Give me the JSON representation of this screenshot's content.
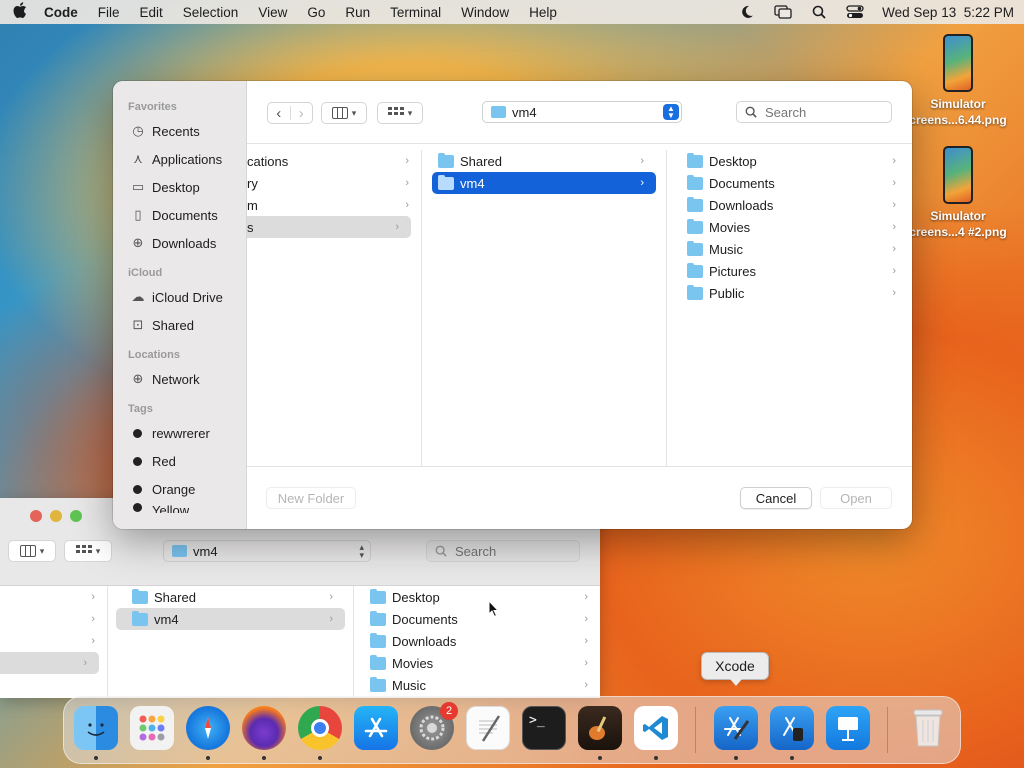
{
  "menubar": {
    "app": "Code",
    "items": [
      "File",
      "Edit",
      "Selection",
      "View",
      "Go",
      "Run",
      "Terminal",
      "Window",
      "Help"
    ],
    "clock": "Wed Sep 13  5:22 PM"
  },
  "desktop": {
    "icons": [
      {
        "line1": "Simulator",
        "line2": "creens...6.44.png"
      },
      {
        "line1": "Simulator",
        "line2": "creens...4 #2.png"
      }
    ]
  },
  "dialog": {
    "sidebar": {
      "favorites_label": "Favorites",
      "favorites": [
        "Recents",
        "Applications",
        "Desktop",
        "Documents",
        "Downloads"
      ],
      "icloud_label": "iCloud",
      "icloud": [
        "iCloud Drive",
        "Shared"
      ],
      "locations_label": "Locations",
      "locations": [
        "Network"
      ],
      "tags_label": "Tags",
      "tags": [
        {
          "label": "rewwrerer",
          "color": "#222222"
        },
        {
          "label": "Red",
          "color": "#222222"
        },
        {
          "label": "Orange",
          "color": "#222222"
        },
        {
          "label": "Yellow",
          "color": "#222222"
        }
      ]
    },
    "path": "vm4",
    "search_placeholder": "Search",
    "col1": [
      "cations",
      "ry",
      "m",
      "s"
    ],
    "col2": [
      "Shared",
      "vm4"
    ],
    "col3": [
      "Desktop",
      "Documents",
      "Downloads",
      "Movies",
      "Music",
      "Pictures",
      "Public"
    ],
    "new_folder": "New Folder",
    "cancel": "Cancel",
    "open": "Open"
  },
  "back_window": {
    "path": "vm4",
    "search_placeholder": "Search",
    "col2": [
      "Shared",
      "vm4"
    ],
    "col3": [
      "Desktop",
      "Documents",
      "Downloads",
      "Movies",
      "Music"
    ]
  },
  "dock": {
    "tooltip": "Xcode",
    "badge": "2",
    "apps": [
      "finder-icon",
      "launchpad-icon",
      "safari-icon",
      "firefox-icon",
      "chrome-icon",
      "app-store-icon",
      "system-settings-icon",
      "textedit-icon",
      "terminal-icon",
      "garageband-icon",
      "vscode-icon",
      "xcode-icon",
      "simulator-icon",
      "keynote-icon",
      "trash-icon"
    ],
    "terminal_glyph": ">_"
  },
  "colors": {
    "accent": "#1462d9",
    "folder": "#7ac4f0"
  }
}
